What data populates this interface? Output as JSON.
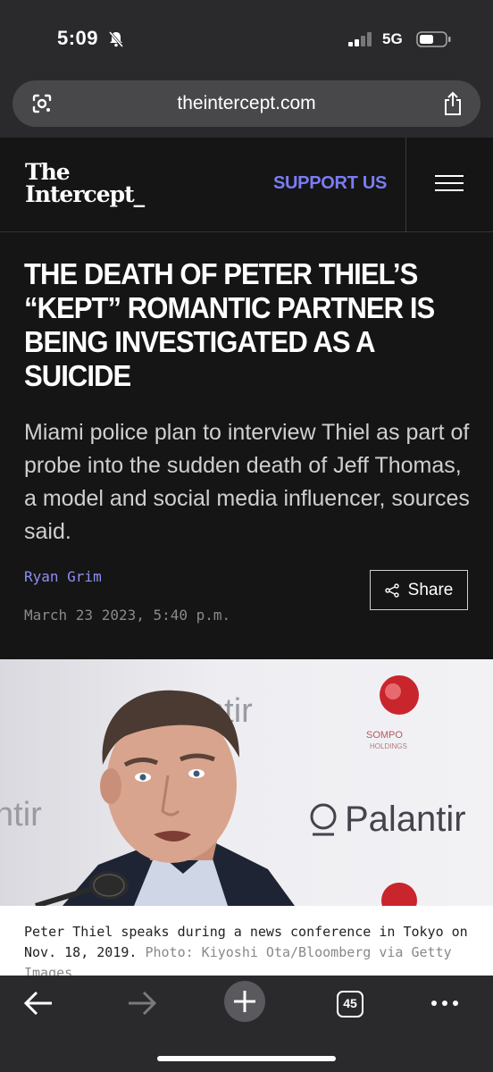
{
  "status": {
    "time": "5:09",
    "network": "5G"
  },
  "browser": {
    "url": "theintercept.com",
    "tab_count": "45"
  },
  "site": {
    "logo_line1": "The",
    "logo_line2": "Intercept_",
    "support_label": "SUPPORT US"
  },
  "article": {
    "headline": "THE DEATH OF PETER THIEL’S “KEPT” ROMANTIC PARTNER IS BEING INVESTIGATED AS A SUICIDE",
    "dek": "Miami police plan to interview Thiel as part of probe into the sudden death of Jeff Thomas, a model and social media influencer, sources said.",
    "author": "Ryan Grim",
    "date": "March 23 2023, 5:40 p.m.",
    "share_label": "Share"
  },
  "photo": {
    "backdrop_text_1": "ntir",
    "backdrop_text_2": "ntir",
    "backdrop_text_3": "Palantir",
    "backdrop_text_4": "SOMPO",
    "backdrop_text_5": "HOLDINGS"
  },
  "caption": {
    "text": "Peter Thiel speaks during a news conference in Tokyo on Nov. 18, 2019.",
    "credit": "Photo: Kiyoshi Ota/Bloomberg via Getty Images"
  },
  "colors": {
    "accent": "#7b7cf5",
    "background": "#151515",
    "chrome": "#2a2a2c"
  }
}
